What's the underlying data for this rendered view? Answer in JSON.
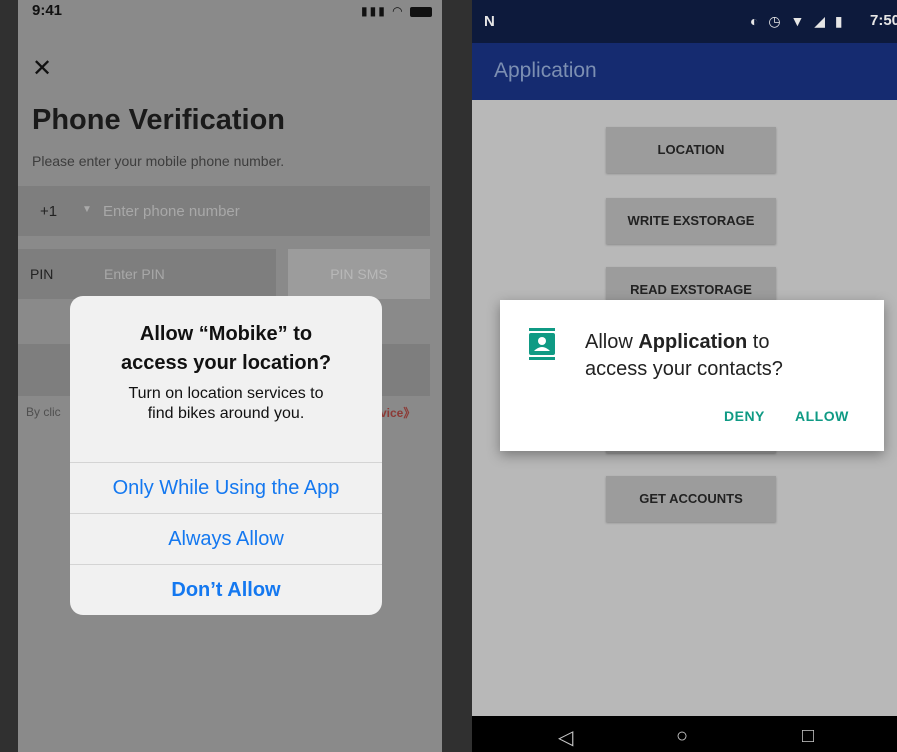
{
  "ios": {
    "status_time": "9:41",
    "close_icon": "✕",
    "title": "Phone Verification",
    "subtitle": "Please enter your mobile phone number.",
    "country_code": "+1",
    "phone_placeholder": "Enter phone number",
    "pin_label": "PIN",
    "pin_placeholder": "Enter PIN",
    "pin_sms_label": "PIN SMS",
    "terms_left_fragment": "By clic",
    "terms_right_fragment": "vice》",
    "alert": {
      "title_line1": "Allow “Mobike” to",
      "title_line2": "access your location?",
      "message_line1": "Turn on location services to",
      "message_line2": "find bikes around you.",
      "option_while_using": "Only While Using the App",
      "option_always": "Always Allow",
      "option_dont": "Don’t Allow"
    }
  },
  "android": {
    "status_time": "7:50",
    "app_title": "Application",
    "buttons": {
      "location": "LOCATION",
      "write_storage": "WRITE EXSTORAGE",
      "read_storage": "READ EXSTORAGE",
      "get_accounts": "GET ACCOUNTS"
    },
    "dialog": {
      "prefix": "Allow ",
      "app_name": "Application",
      "suffix": " to",
      "line2": "access your contacts?",
      "deny": "DENY",
      "allow": "ALLOW"
    }
  },
  "colors": {
    "ios_link_blue": "#1478f0",
    "android_accent_teal": "#0f9a84",
    "android_appbar": "#152b70"
  },
  "icons": [
    "close-icon",
    "signal-icon",
    "wifi-icon",
    "battery-icon",
    "contacts-icon",
    "back-icon",
    "home-icon",
    "recents-icon"
  ]
}
